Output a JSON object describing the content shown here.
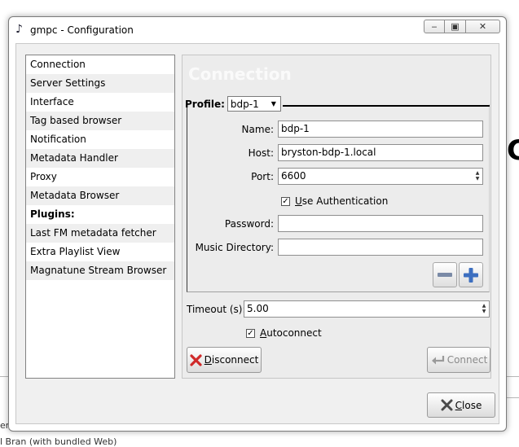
{
  "window": {
    "title": "gmpc - Configuration",
    "controls": {
      "minimize": "‒",
      "maximize": "▣",
      "close": "✕"
    }
  },
  "sidebar": {
    "items": [
      {
        "label": "Connection",
        "bold": false
      },
      {
        "label": "Server Settings",
        "bold": false
      },
      {
        "label": "Interface",
        "bold": false
      },
      {
        "label": "Tag based browser",
        "bold": false
      },
      {
        "label": "Notification",
        "bold": false
      },
      {
        "label": "Metadata Handler",
        "bold": false
      },
      {
        "label": "Proxy",
        "bold": false
      },
      {
        "label": "Metadata Browser",
        "bold": false
      },
      {
        "label": "Plugins:",
        "bold": true
      },
      {
        "label": "Last FM metadata fetcher",
        "bold": false
      },
      {
        "label": "Extra Playlist View",
        "bold": false
      },
      {
        "label": "Magnatune Stream Browser",
        "bold": false
      }
    ]
  },
  "connection": {
    "heading": "Connection",
    "profile_label": "Profile:",
    "profile_value": "bdp-1",
    "name_label": "Name:",
    "name_value": "bdp-1",
    "host_label": "Host:",
    "host_value": "bryston-bdp-1.local",
    "port_label": "Port:",
    "port_value": "6600",
    "use_auth_label": "Use Authentication",
    "use_auth_checked": true,
    "password_label": "Password:",
    "password_value": "",
    "music_dir_label": "Music Directory:",
    "music_dir_value": "",
    "timeout_label": "Timeout (s):",
    "timeout_value": "5.00",
    "autoconnect_label": "Autoconnect",
    "autoconnect_checked": true,
    "disconnect_label": "Disconnect",
    "connect_label": "Connect",
    "close_label": "Close"
  },
  "icons": {
    "app": "music-note-icon",
    "remove": "minus-icon",
    "add": "plus-icon",
    "disconnect": "red-x-icon",
    "connect": "arrow-connect-icon",
    "close": "close-x-icon"
  },
  "colors": {
    "remove_icon": "#7a8aa6",
    "add_icon": "#3d6fc0",
    "disconnect_icon": "#d02a2a"
  }
}
